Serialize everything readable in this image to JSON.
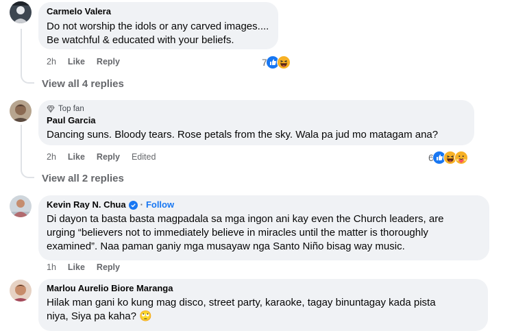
{
  "comments": [
    {
      "author": "Carmelo Valera",
      "lines": [
        "Do not worship the idols or any carved images....",
        "Be watchful & educated with your beliefs."
      ],
      "time": "2h",
      "like": "Like",
      "reply": "Reply",
      "reaction_count": "7",
      "reactions": [
        "like",
        "haha"
      ],
      "view_replies": "View all 4 replies"
    },
    {
      "badge": "Top fan",
      "author": "Paul Garcia",
      "lines": [
        "Dancing suns. Bloody tears. Rose petals from the sky. Wala pa jud mo matagam ana?"
      ],
      "time": "2h",
      "like": "Like",
      "reply": "Reply",
      "edited": "Edited",
      "reaction_count": "6",
      "reactions": [
        "like",
        "haha",
        "care"
      ],
      "view_replies": "View all 2 replies"
    },
    {
      "author": "Kevin Ray N. Chua",
      "follow": "Follow",
      "lines": [
        "Di dayon ta basta basta magpadala sa mga ingon ani kay even the Church leaders, are",
        "urging “believers not to immediately believe in miracles until the matter is thoroughly",
        "examined”. Naa paman ganiy mga musayaw nga Santo Niño bisag way music."
      ],
      "time": "1h",
      "like": "Like",
      "reply": "Reply"
    },
    {
      "author": "Marlou Aurelio Biore Maranga",
      "lines": [
        "Hilak man gani ko kung mag disco, street party, karaoke, tagay binuntagay kada pista",
        "niya, Siya pa kaha? 🙄"
      ]
    }
  ],
  "colors": {
    "bubble": "#f0f2f5",
    "meta": "#65676b",
    "facebook_blue": "#1877f2",
    "haha_yellow": "#f7b125"
  }
}
